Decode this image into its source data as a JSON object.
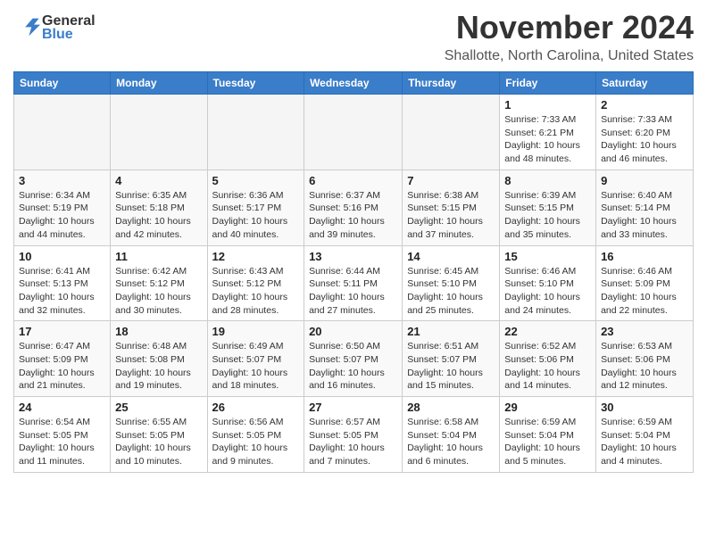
{
  "header": {
    "logo_line1": "General",
    "logo_line2": "Blue",
    "month_title": "November 2024",
    "location": "Shallotte, North Carolina, United States"
  },
  "weekdays": [
    "Sunday",
    "Monday",
    "Tuesday",
    "Wednesday",
    "Thursday",
    "Friday",
    "Saturday"
  ],
  "weeks": [
    [
      {
        "day": "",
        "info": ""
      },
      {
        "day": "",
        "info": ""
      },
      {
        "day": "",
        "info": ""
      },
      {
        "day": "",
        "info": ""
      },
      {
        "day": "",
        "info": ""
      },
      {
        "day": "1",
        "info": "Sunrise: 7:33 AM\nSunset: 6:21 PM\nDaylight: 10 hours\nand 48 minutes."
      },
      {
        "day": "2",
        "info": "Sunrise: 7:33 AM\nSunset: 6:20 PM\nDaylight: 10 hours\nand 46 minutes."
      }
    ],
    [
      {
        "day": "3",
        "info": "Sunrise: 6:34 AM\nSunset: 5:19 PM\nDaylight: 10 hours\nand 44 minutes."
      },
      {
        "day": "4",
        "info": "Sunrise: 6:35 AM\nSunset: 5:18 PM\nDaylight: 10 hours\nand 42 minutes."
      },
      {
        "day": "5",
        "info": "Sunrise: 6:36 AM\nSunset: 5:17 PM\nDaylight: 10 hours\nand 40 minutes."
      },
      {
        "day": "6",
        "info": "Sunrise: 6:37 AM\nSunset: 5:16 PM\nDaylight: 10 hours\nand 39 minutes."
      },
      {
        "day": "7",
        "info": "Sunrise: 6:38 AM\nSunset: 5:15 PM\nDaylight: 10 hours\nand 37 minutes."
      },
      {
        "day": "8",
        "info": "Sunrise: 6:39 AM\nSunset: 5:15 PM\nDaylight: 10 hours\nand 35 minutes."
      },
      {
        "day": "9",
        "info": "Sunrise: 6:40 AM\nSunset: 5:14 PM\nDaylight: 10 hours\nand 33 minutes."
      }
    ],
    [
      {
        "day": "10",
        "info": "Sunrise: 6:41 AM\nSunset: 5:13 PM\nDaylight: 10 hours\nand 32 minutes."
      },
      {
        "day": "11",
        "info": "Sunrise: 6:42 AM\nSunset: 5:12 PM\nDaylight: 10 hours\nand 30 minutes."
      },
      {
        "day": "12",
        "info": "Sunrise: 6:43 AM\nSunset: 5:12 PM\nDaylight: 10 hours\nand 28 minutes."
      },
      {
        "day": "13",
        "info": "Sunrise: 6:44 AM\nSunset: 5:11 PM\nDaylight: 10 hours\nand 27 minutes."
      },
      {
        "day": "14",
        "info": "Sunrise: 6:45 AM\nSunset: 5:10 PM\nDaylight: 10 hours\nand 25 minutes."
      },
      {
        "day": "15",
        "info": "Sunrise: 6:46 AM\nSunset: 5:10 PM\nDaylight: 10 hours\nand 24 minutes."
      },
      {
        "day": "16",
        "info": "Sunrise: 6:46 AM\nSunset: 5:09 PM\nDaylight: 10 hours\nand 22 minutes."
      }
    ],
    [
      {
        "day": "17",
        "info": "Sunrise: 6:47 AM\nSunset: 5:09 PM\nDaylight: 10 hours\nand 21 minutes."
      },
      {
        "day": "18",
        "info": "Sunrise: 6:48 AM\nSunset: 5:08 PM\nDaylight: 10 hours\nand 19 minutes."
      },
      {
        "day": "19",
        "info": "Sunrise: 6:49 AM\nSunset: 5:07 PM\nDaylight: 10 hours\nand 18 minutes."
      },
      {
        "day": "20",
        "info": "Sunrise: 6:50 AM\nSunset: 5:07 PM\nDaylight: 10 hours\nand 16 minutes."
      },
      {
        "day": "21",
        "info": "Sunrise: 6:51 AM\nSunset: 5:07 PM\nDaylight: 10 hours\nand 15 minutes."
      },
      {
        "day": "22",
        "info": "Sunrise: 6:52 AM\nSunset: 5:06 PM\nDaylight: 10 hours\nand 14 minutes."
      },
      {
        "day": "23",
        "info": "Sunrise: 6:53 AM\nSunset: 5:06 PM\nDaylight: 10 hours\nand 12 minutes."
      }
    ],
    [
      {
        "day": "24",
        "info": "Sunrise: 6:54 AM\nSunset: 5:05 PM\nDaylight: 10 hours\nand 11 minutes."
      },
      {
        "day": "25",
        "info": "Sunrise: 6:55 AM\nSunset: 5:05 PM\nDaylight: 10 hours\nand 10 minutes."
      },
      {
        "day": "26",
        "info": "Sunrise: 6:56 AM\nSunset: 5:05 PM\nDaylight: 10 hours\nand 9 minutes."
      },
      {
        "day": "27",
        "info": "Sunrise: 6:57 AM\nSunset: 5:05 PM\nDaylight: 10 hours\nand 7 minutes."
      },
      {
        "day": "28",
        "info": "Sunrise: 6:58 AM\nSunset: 5:04 PM\nDaylight: 10 hours\nand 6 minutes."
      },
      {
        "day": "29",
        "info": "Sunrise: 6:59 AM\nSunset: 5:04 PM\nDaylight: 10 hours\nand 5 minutes."
      },
      {
        "day": "30",
        "info": "Sunrise: 6:59 AM\nSunset: 5:04 PM\nDaylight: 10 hours\nand 4 minutes."
      }
    ]
  ]
}
